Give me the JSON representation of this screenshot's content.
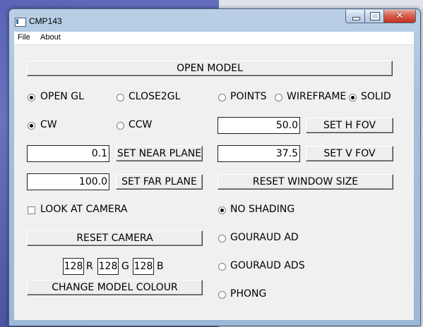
{
  "window": {
    "title": "CMP143",
    "close_glyph": "✕"
  },
  "menu": [
    "File",
    "About"
  ],
  "buttons": {
    "open_model": "OPEN MODEL",
    "set_near_plane": "SET NEAR PLANE",
    "set_far_plane": "SET FAR PLANE",
    "reset_camera": "RESET CAMERA",
    "change_model_colour": "CHANGE MODEL COLOUR",
    "set_h_fov": "SET H FOV",
    "set_v_fov": "SET V FOV",
    "reset_window_size": "RESET WINDOW SIZE"
  },
  "renderer": {
    "open_gl": {
      "label": "OPEN GL",
      "selected": true
    },
    "close2gl": {
      "label": "CLOSE2GL",
      "selected": false
    }
  },
  "winding": {
    "cw": {
      "label": "CW",
      "selected": true
    },
    "ccw": {
      "label": "CCW",
      "selected": false
    }
  },
  "draw_mode": {
    "points": {
      "label": "POINTS",
      "selected": false
    },
    "wireframe": {
      "label": "WIREFRAME",
      "selected": false
    },
    "solid": {
      "label": "SOLID",
      "selected": true
    }
  },
  "fields": {
    "near_plane": "0.1",
    "far_plane": "100.0",
    "h_fov": "50.0",
    "v_fov": "37.5"
  },
  "look_at_camera": {
    "label": "LOOK AT CAMERA",
    "checked": false
  },
  "colour": {
    "r": {
      "value": "128",
      "label": "R"
    },
    "g": {
      "value": "128",
      "label": "G"
    },
    "b": {
      "value": "128",
      "label": "B"
    }
  },
  "shading": {
    "none": {
      "label": "NO SHADING",
      "selected": true
    },
    "gouraud_ad": {
      "label": "GOURAUD AD",
      "selected": false
    },
    "gouraud_ads": {
      "label": "GOURAUD ADS",
      "selected": false
    },
    "phong": {
      "label": "PHONG",
      "selected": false
    }
  }
}
